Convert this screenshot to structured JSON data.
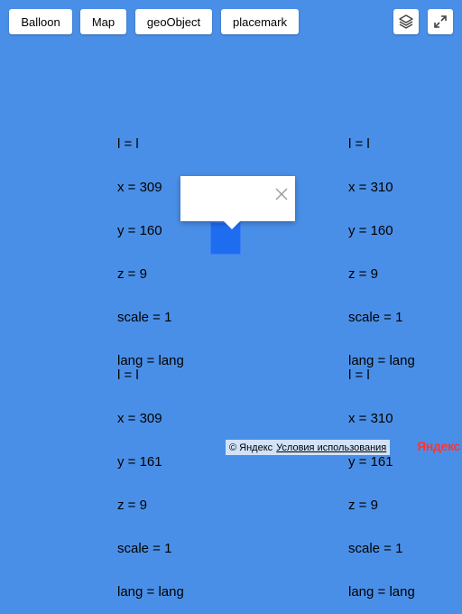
{
  "toolbar": {
    "buttons": [
      {
        "label": "Balloon"
      },
      {
        "label": "Map"
      },
      {
        "label": "geoObject"
      },
      {
        "label": "placemark"
      }
    ],
    "layers_icon": "layers-icon",
    "fullscreen_icon": "fullscreen-icon"
  },
  "tiles": [
    {
      "l": "l = l",
      "x": "x = 309",
      "y": "y = 160",
      "z": "z = 9",
      "scale": "scale = 1",
      "lang": "lang = lang"
    },
    {
      "l": "l = l",
      "x": "x = 310",
      "y": "y = 160",
      "z": "z = 9",
      "scale": "scale = 1",
      "lang": "lang = lang"
    },
    {
      "l": "l = l",
      "x": "x = 309",
      "y": "y = 161",
      "z": "z = 9",
      "scale": "scale = 1",
      "lang": "lang = lang"
    },
    {
      "l": "l = l",
      "x": "x = 310",
      "y": "y = 161",
      "z": "z = 9",
      "scale": "scale = 1",
      "lang": "lang = lang"
    }
  ],
  "balloon": {
    "content": "",
    "close_icon": "close-icon"
  },
  "footer": {
    "copyright": "© Яндекс",
    "terms": "Условия использования",
    "logo": "Яндекс"
  },
  "colors": {
    "map_background": "#4a8fe7",
    "marker": "#1e6cf0",
    "logo": "#ff3333"
  }
}
